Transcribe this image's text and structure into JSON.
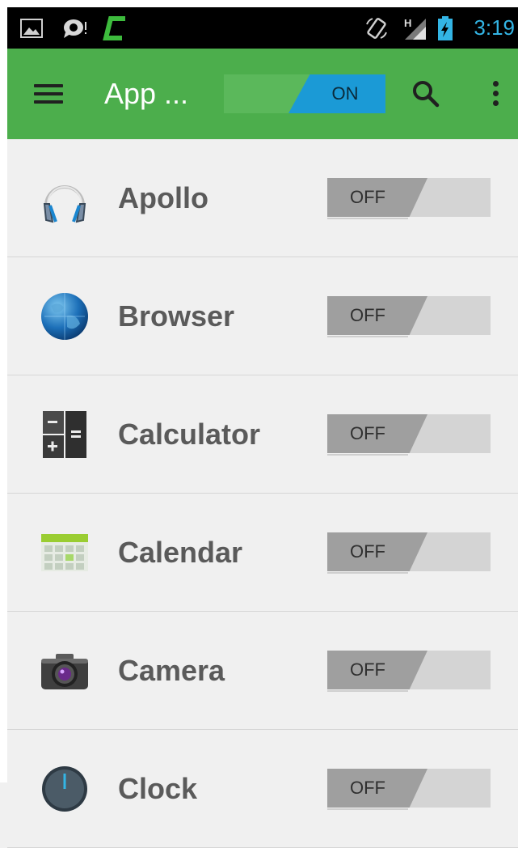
{
  "status_bar": {
    "time": "3:19",
    "icons": [
      "picture-icon",
      "chat-icon",
      "c-app-icon",
      "rotate-icon",
      "signal-h-icon",
      "battery-charging-icon"
    ],
    "accent_color": "#33b5e5"
  },
  "action_bar": {
    "title": "App ...",
    "master_toggle_label": "ON",
    "master_toggle_state": true,
    "background_color": "#4cae4c"
  },
  "apps": [
    {
      "name": "Apollo",
      "toggle_label": "OFF",
      "state": false,
      "icon": "headphones-icon"
    },
    {
      "name": "Browser",
      "toggle_label": "OFF",
      "state": false,
      "icon": "globe-icon"
    },
    {
      "name": "Calculator",
      "toggle_label": "OFF",
      "state": false,
      "icon": "calculator-icon"
    },
    {
      "name": "Calendar",
      "toggle_label": "OFF",
      "state": false,
      "icon": "calendar-icon"
    },
    {
      "name": "Camera",
      "toggle_label": "OFF",
      "state": false,
      "icon": "camera-icon"
    },
    {
      "name": "Clock",
      "toggle_label": "OFF",
      "state": false,
      "icon": "clock-icon"
    }
  ]
}
